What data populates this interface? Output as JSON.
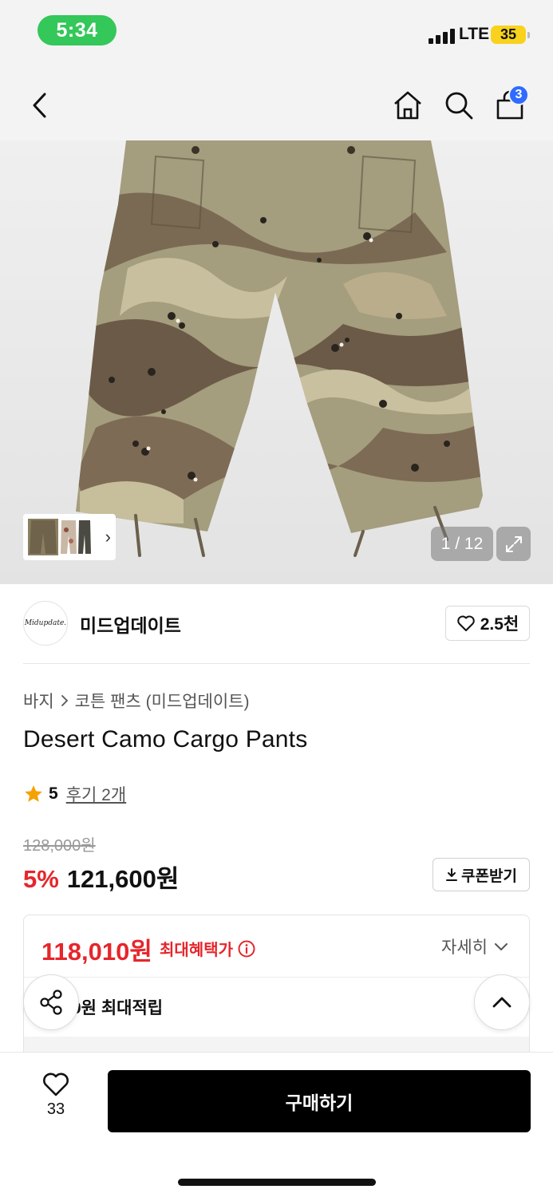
{
  "status_bar": {
    "time": "5:34",
    "network": "LTE",
    "battery": "35"
  },
  "nav": {
    "cart_count": "3"
  },
  "gallery": {
    "counter": "1 / 12"
  },
  "brand": {
    "logo_text": "Midupdate.",
    "name": "미드업데이트",
    "likes": "2.5천"
  },
  "breadcrumb": {
    "category": "바지",
    "subcategory": "코튼 팬츠 (미드업데이트)"
  },
  "product": {
    "title": "Desert Camo Cargo Pants",
    "rating": "5",
    "reviews": "후기 2개",
    "original_price": "128,000원",
    "discount": "5%",
    "sale_price": "121,600원",
    "coupon_label": "쿠폰받기"
  },
  "benefit": {
    "max_price": "118,010원",
    "max_label": "최대혜택가",
    "detail_label": "자세히",
    "points": "0원 최대적립"
  },
  "bottom_bar": {
    "wish_count": "33",
    "buy_label": "구매하기"
  },
  "colors": {
    "accent_red": "#e5262b",
    "status_green": "#34c759",
    "badge_blue": "#2f6bff",
    "battery_yellow": "#f8d21c"
  }
}
